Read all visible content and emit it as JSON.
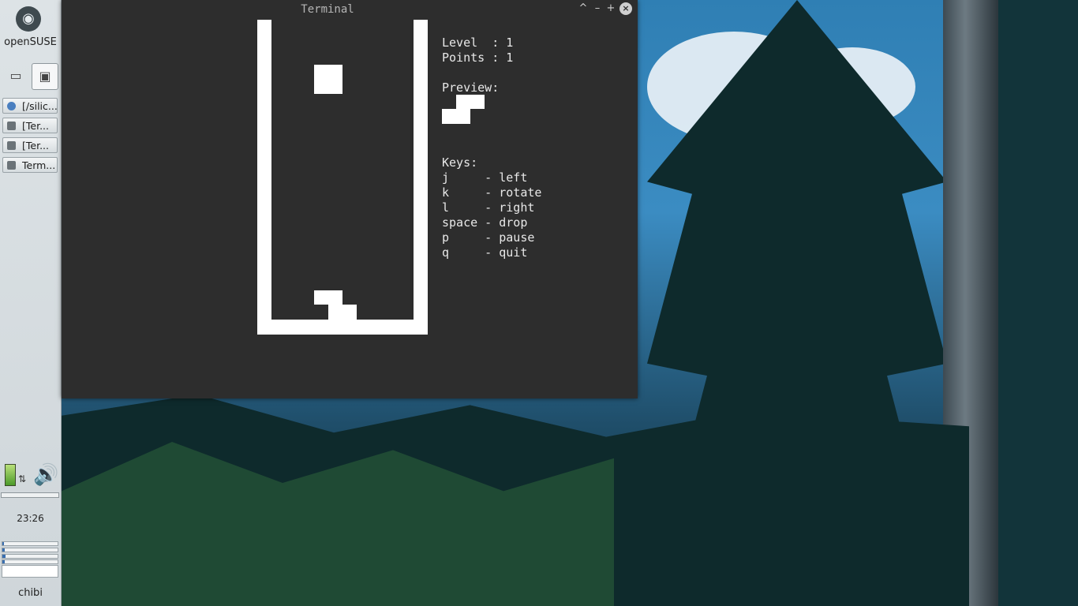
{
  "panel": {
    "brand": "openSUSE",
    "tasks": [
      {
        "label": "[/silic..."
      },
      {
        "label": "[Ter..."
      },
      {
        "label": "[Ter..."
      },
      {
        "label": "Term..."
      }
    ],
    "clock": "23:26",
    "user": "chibi"
  },
  "window": {
    "title": "Terminal",
    "buttons": {
      "maximize_up": "^",
      "minimize": "–",
      "add": "+",
      "close": "×"
    }
  },
  "game": {
    "level_line": "Level  : 1",
    "points_line": "Points : 1",
    "preview_label": "Preview:",
    "keys_label": "Keys:",
    "keys": [
      {
        "key": "j    ",
        "action": "left"
      },
      {
        "key": "k    ",
        "action": "rotate"
      },
      {
        "key": "l    ",
        "action": "right"
      },
      {
        "key": "space",
        "action": "drop"
      },
      {
        "key": "p    ",
        "action": "pause"
      },
      {
        "key": "q    ",
        "action": "quit"
      }
    ]
  },
  "colors": {
    "terminal_bg": "#2d2d2d",
    "terminal_fg": "#e8e8e8",
    "blocks": "#ffffff"
  }
}
